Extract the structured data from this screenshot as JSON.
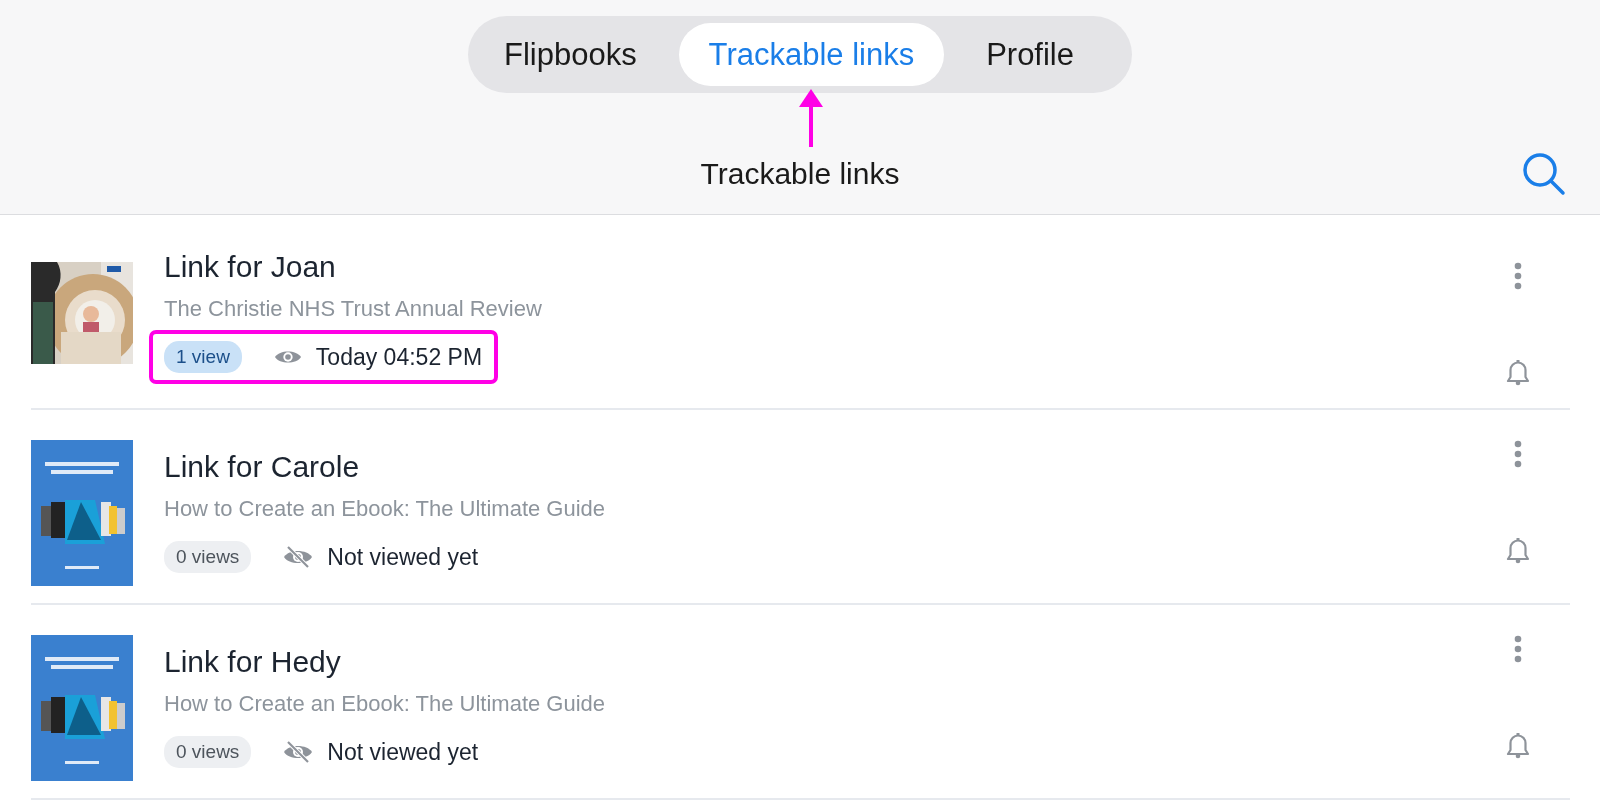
{
  "tabs": [
    {
      "label": "Flipbooks",
      "selected": false,
      "pointed": false
    },
    {
      "label": "Trackable links",
      "selected": true,
      "pointed": true
    },
    {
      "label": "Profile",
      "selected": false,
      "pointed": false
    }
  ],
  "header": {
    "title": "Trackable links"
  },
  "links": [
    {
      "title": "Link for Joan",
      "publication": "The Christie NHS Trust Annual Review",
      "views": "1 view",
      "viewed": true,
      "last_view": "Today 04:52 PM",
      "highlighted": true
    },
    {
      "title": "Link for Carole",
      "publication": "How to Create an Ebook: The Ultimate Guide",
      "views": "0 views",
      "viewed": false,
      "last_view": "Not viewed yet",
      "highlighted": false
    },
    {
      "title": "Link for Hedy",
      "publication": "How to Create an Ebook: The Ultimate Guide",
      "views": "0 views",
      "viewed": false,
      "last_view": "Not viewed yet",
      "highlighted": false
    }
  ]
}
